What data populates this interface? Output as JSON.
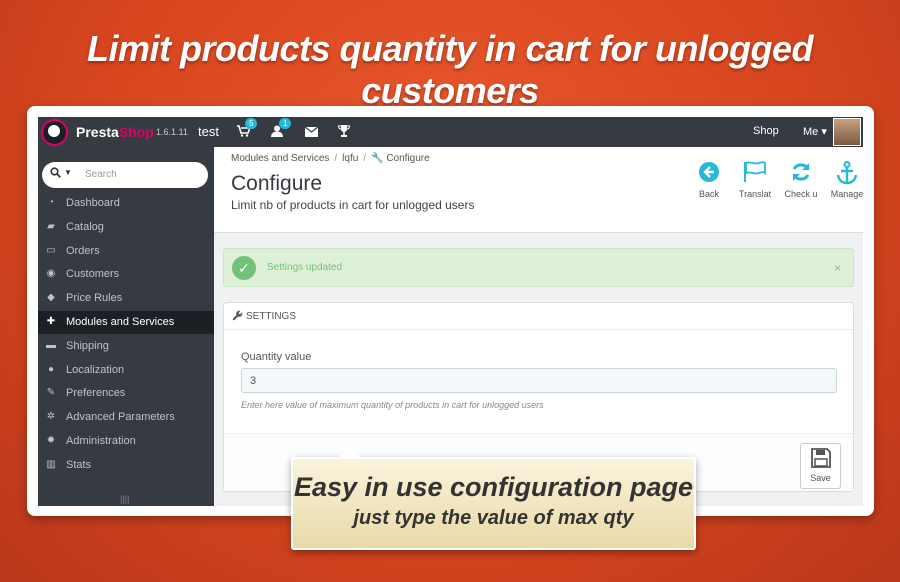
{
  "headline": "Limit products quantity in cart for unlogged customers",
  "topbar": {
    "brand_a": "Presta",
    "brand_b": "Shop",
    "version": "1.6.1.11",
    "shop_name": "test",
    "cart_badge": "5",
    "customer_badge": "1",
    "shop_link": "Shop",
    "me_link": "Me ▾"
  },
  "sidebar": {
    "search_placeholder": "Search",
    "items": [
      {
        "label": "Dashboard",
        "icon": "tachometer-icon"
      },
      {
        "label": "Catalog",
        "icon": "book-icon"
      },
      {
        "label": "Orders",
        "icon": "credit-card-icon"
      },
      {
        "label": "Customers",
        "icon": "users-icon"
      },
      {
        "label": "Price Rules",
        "icon": "tags-icon"
      },
      {
        "label": "Modules and Services",
        "icon": "puzzle-icon"
      },
      {
        "label": "Shipping",
        "icon": "truck-icon"
      },
      {
        "label": "Localization",
        "icon": "globe-icon"
      },
      {
        "label": "Preferences",
        "icon": "wrench-icon"
      },
      {
        "label": "Advanced Parameters",
        "icon": "cogs-icon"
      },
      {
        "label": "Administration",
        "icon": "cog-icon"
      },
      {
        "label": "Stats",
        "icon": "bar-chart-icon"
      }
    ],
    "active_index": 5
  },
  "header": {
    "breadcrumb": [
      "Modules and Services",
      "lqfu",
      "Configure"
    ],
    "title": "Configure",
    "subtitle": "Limit nb of products in cart for unlogged users",
    "toolbar": [
      {
        "label": "Back",
        "icon": "arrow-circle-left-icon"
      },
      {
        "label": "Translat",
        "icon": "flag-icon"
      },
      {
        "label": "Check u",
        "icon": "refresh-icon"
      },
      {
        "label": "Manage",
        "icon": "anchor-icon"
      }
    ]
  },
  "alert": {
    "message": "Settings updated",
    "close": "×"
  },
  "panel": {
    "heading": "SETTINGS",
    "field_label": "Quantity value",
    "field_value": "3",
    "help": "Enter here value of maximum quantity of products in cart for unlogged users",
    "save_label": "Save"
  },
  "callout": {
    "line1": "Easy in use configuration page",
    "line2": "just type the value of max qty"
  },
  "colors": {
    "background": "#d8461f",
    "topbar": "#363a41",
    "accent": "#25b9d7",
    "brand_pink": "#df0067",
    "success": "#72c279"
  }
}
